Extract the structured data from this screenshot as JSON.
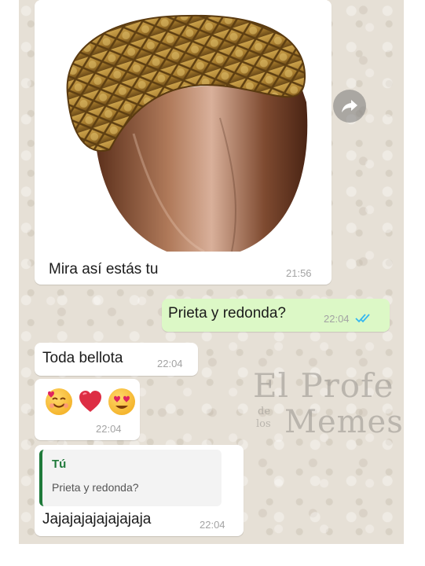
{
  "messages": [
    {
      "id": "img",
      "direction": "incoming",
      "type": "image",
      "text": "Mira así estás tu",
      "time": "21:56"
    },
    {
      "id": "m2",
      "direction": "outgoing",
      "text": "Prieta y redonda?",
      "time": "22:04",
      "status": "read",
      "status_color": "#34b7f1"
    },
    {
      "id": "m3",
      "direction": "incoming",
      "text": "Toda bellota",
      "time": "22:04"
    },
    {
      "id": "m4",
      "direction": "incoming",
      "emojis": [
        "smiling-face-with-hearts",
        "red-heart",
        "heart-eyes"
      ],
      "time": "22:04"
    },
    {
      "id": "m5",
      "direction": "incoming",
      "reply_to": {
        "author": "Tú",
        "text": "Prieta y redonda?"
      },
      "text": "Jajajajajajajajaja",
      "time": "22:04"
    }
  ],
  "watermark": {
    "line1": "El Profe",
    "de": "de",
    "los": "los",
    "line2": "Memes"
  },
  "icons": {
    "forward": "forward-icon",
    "read_receipt": "double-check-icon"
  },
  "colors": {
    "outgoing_bubble": "#dcf8c6",
    "incoming_bubble": "#ffffff",
    "quote_accent": "#1f7a3a"
  }
}
